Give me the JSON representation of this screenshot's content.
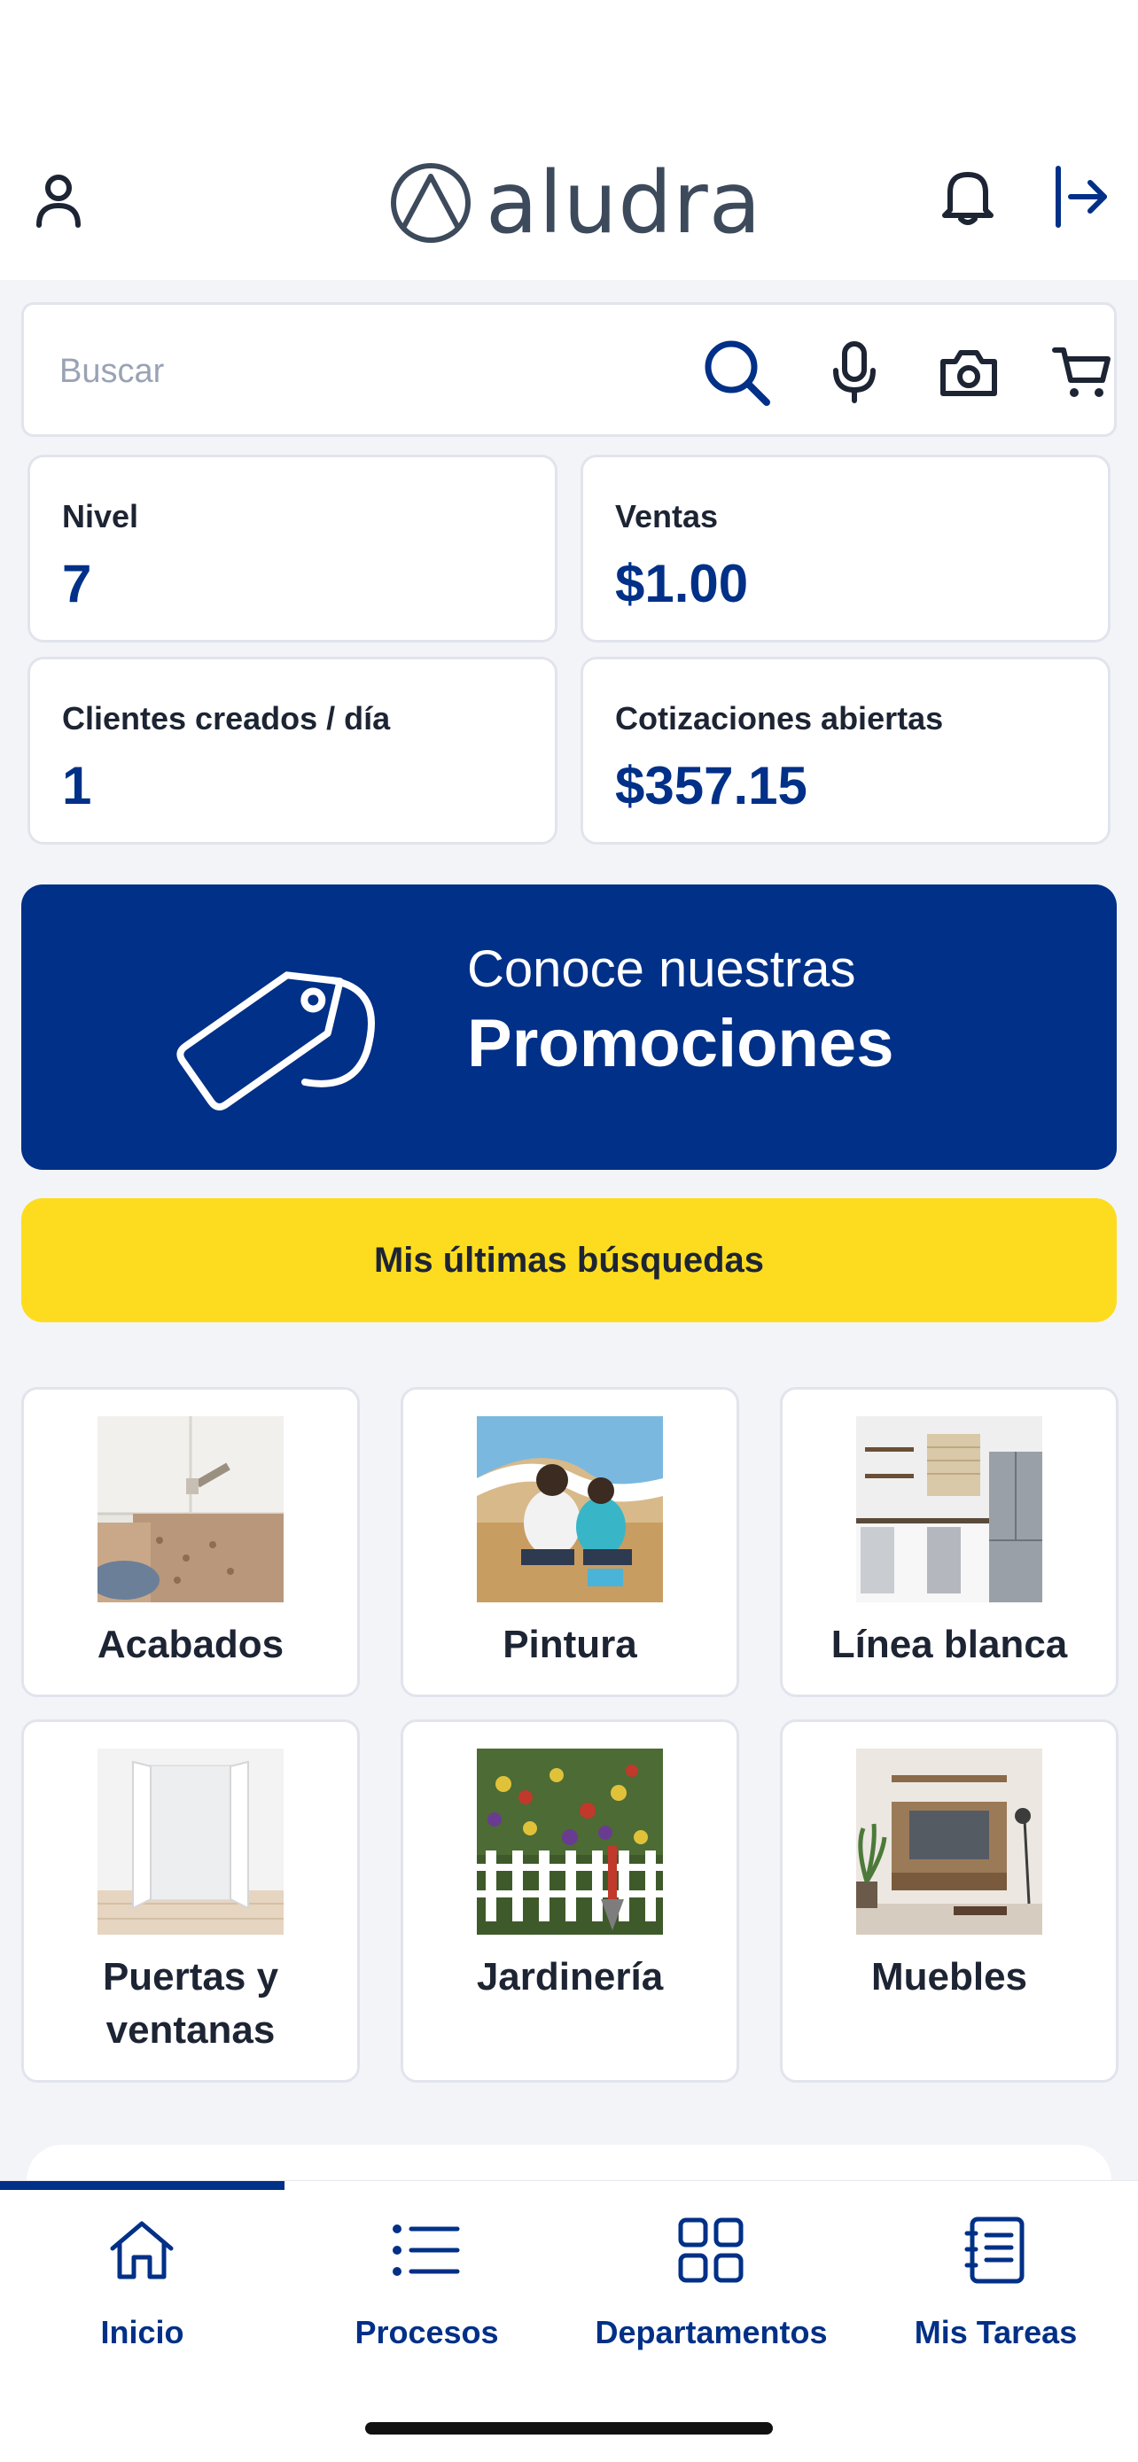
{
  "app": {
    "brand": "aludra"
  },
  "search": {
    "placeholder": "Buscar"
  },
  "stats": [
    {
      "label": "Nivel",
      "value": "7"
    },
    {
      "label": "Ventas",
      "value": "$1.00"
    },
    {
      "label": "Clientes creados / día",
      "value": "1"
    },
    {
      "label": "Cotizaciones abiertas",
      "value": "$357.15"
    }
  ],
  "promo": {
    "subtitle": "Conoce nuestras",
    "title": "Promociones"
  },
  "recent_searches": {
    "label": "Mis últimas búsquedas"
  },
  "categories": [
    {
      "label": "Acabados",
      "icon": "floor-tiling-photo"
    },
    {
      "label": "Pintura",
      "icon": "painting-photo"
    },
    {
      "label": "Línea blanca",
      "icon": "kitchen-appliances-photo"
    },
    {
      "label": "Puertas y ventanas",
      "icon": "doors-photo"
    },
    {
      "label": "Jardinería",
      "icon": "garden-flowers-photo"
    },
    {
      "label": "Muebles",
      "icon": "furniture-photo"
    }
  ],
  "tabs": [
    {
      "label": "Inicio",
      "icon": "home-icon",
      "active": true
    },
    {
      "label": "Procesos",
      "icon": "list-icon",
      "active": false
    },
    {
      "label": "Departamentos",
      "icon": "grid-icon",
      "active": false
    },
    {
      "label": "Mis Tareas",
      "icon": "notebook-icon",
      "active": false
    }
  ],
  "colors": {
    "primary": "#003087",
    "accent": "#fddc1f",
    "background": "#f3f4f8",
    "text": "#1d2433"
  }
}
